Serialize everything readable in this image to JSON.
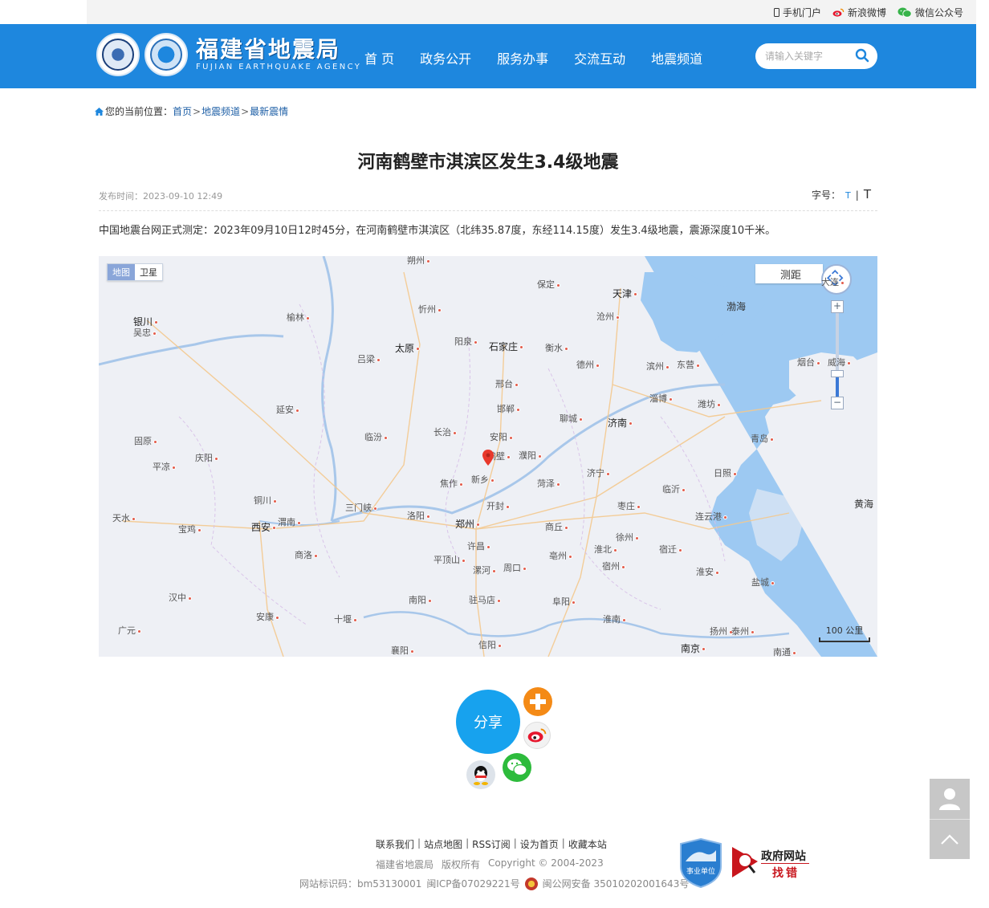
{
  "topbar": {
    "mobile": "手机门户",
    "weibo": "新浪微博",
    "wechat": "微信公众号"
  },
  "header": {
    "logo_cn": "福建省地震局",
    "logo_en": "FUJIAN EARTHQUAKE AGENCY",
    "nav": [
      "首 页",
      "政务公开",
      "服务办事",
      "交流互动",
      "地震频道"
    ],
    "search_placeholder": "请输入关键字"
  },
  "breadcrumb": {
    "prefix": "您的当前位置：",
    "items": [
      "首页",
      "地震频道",
      "最新震情"
    ],
    "sep": ">"
  },
  "article": {
    "title": "河南鹤壁市淇滨区发生3.4级地震",
    "date": "发布时间：2023-09-10 12:49",
    "font_label": "字号：",
    "font_small": "T",
    "font_sep": "|",
    "font_large": "T",
    "body": "中国地震台网正式测定：2023年09月10日12时45分，在河南鹤壁市淇滨区（北纬35.87度，东经114.15度）发生3.4级地震，震源深度10千米。"
  },
  "map": {
    "type_map": "地图",
    "type_sat": "卫星",
    "measure": "测距",
    "zoom_in": "+",
    "zoom_out": "−",
    "scale": "100 公里",
    "cities": [
      {
        "name": "朔州",
        "cls": ""
      },
      {
        "name": "保定",
        "cls": ""
      },
      {
        "name": "天津",
        "cls": "big"
      },
      {
        "name": "渤海",
        "cls": "sea"
      },
      {
        "name": "大连",
        "cls": ""
      },
      {
        "name": "银川",
        "cls": "big"
      },
      {
        "name": "吴忠",
        "cls": ""
      },
      {
        "name": "榆林",
        "cls": ""
      },
      {
        "name": "忻州",
        "cls": ""
      },
      {
        "name": "沧州",
        "cls": ""
      },
      {
        "name": "太原",
        "cls": "big"
      },
      {
        "name": "阳泉",
        "cls": ""
      },
      {
        "name": "石家庄",
        "cls": "big"
      },
      {
        "name": "衡水",
        "cls": ""
      },
      {
        "name": "吕梁",
        "cls": ""
      },
      {
        "name": "德州",
        "cls": ""
      },
      {
        "name": "滨州",
        "cls": ""
      },
      {
        "name": "东营",
        "cls": ""
      },
      {
        "name": "烟台",
        "cls": ""
      },
      {
        "name": "威海",
        "cls": ""
      },
      {
        "name": "邢台",
        "cls": ""
      },
      {
        "name": "淄博",
        "cls": ""
      },
      {
        "name": "潍坊",
        "cls": ""
      },
      {
        "name": "延安",
        "cls": ""
      },
      {
        "name": "邯郸",
        "cls": ""
      },
      {
        "name": "聊城",
        "cls": ""
      },
      {
        "name": "济南",
        "cls": "big"
      },
      {
        "name": "长治",
        "cls": ""
      },
      {
        "name": "临汾",
        "cls": ""
      },
      {
        "name": "安阳",
        "cls": ""
      },
      {
        "name": "青岛",
        "cls": ""
      },
      {
        "name": "固原",
        "cls": ""
      },
      {
        "name": "庆阳",
        "cls": ""
      },
      {
        "name": "鹤壁",
        "cls": ""
      },
      {
        "name": "濮阳",
        "cls": ""
      },
      {
        "name": "平凉",
        "cls": ""
      },
      {
        "name": "新乡",
        "cls": ""
      },
      {
        "name": "济宁",
        "cls": ""
      },
      {
        "name": "日照",
        "cls": ""
      },
      {
        "name": "焦作",
        "cls": ""
      },
      {
        "name": "菏泽",
        "cls": ""
      },
      {
        "name": "临沂",
        "cls": ""
      },
      {
        "name": "铜川",
        "cls": ""
      },
      {
        "name": "三门峡",
        "cls": ""
      },
      {
        "name": "开封",
        "cls": ""
      },
      {
        "name": "枣庄",
        "cls": ""
      },
      {
        "name": "黄海",
        "cls": "sea"
      },
      {
        "name": "天水",
        "cls": ""
      },
      {
        "name": "洛阳",
        "cls": ""
      },
      {
        "name": "连云港",
        "cls": ""
      },
      {
        "name": "宝鸡",
        "cls": ""
      },
      {
        "name": "西安",
        "cls": "big"
      },
      {
        "name": "渭南",
        "cls": ""
      },
      {
        "name": "郑州",
        "cls": "big"
      },
      {
        "name": "商丘",
        "cls": ""
      },
      {
        "name": "徐州",
        "cls": ""
      },
      {
        "name": "商洛",
        "cls": ""
      },
      {
        "name": "许昌",
        "cls": ""
      },
      {
        "name": "淮北",
        "cls": ""
      },
      {
        "name": "宿迁",
        "cls": ""
      },
      {
        "name": "平顶山",
        "cls": ""
      },
      {
        "name": "亳州",
        "cls": ""
      },
      {
        "name": "漯河",
        "cls": ""
      },
      {
        "name": "周口",
        "cls": ""
      },
      {
        "name": "宿州",
        "cls": ""
      },
      {
        "name": "淮安",
        "cls": ""
      },
      {
        "name": "盐城",
        "cls": ""
      },
      {
        "name": "汉中",
        "cls": ""
      },
      {
        "name": "南阳",
        "cls": ""
      },
      {
        "name": "驻马店",
        "cls": ""
      },
      {
        "name": "阜阳",
        "cls": ""
      },
      {
        "name": "安康",
        "cls": ""
      },
      {
        "name": "十堰",
        "cls": ""
      },
      {
        "name": "淮南",
        "cls": ""
      },
      {
        "name": "扬州",
        "cls": ""
      },
      {
        "name": "泰州",
        "cls": ""
      },
      {
        "name": "广元",
        "cls": ""
      },
      {
        "name": "襄阳",
        "cls": ""
      },
      {
        "name": "信阳",
        "cls": ""
      },
      {
        "name": "南京",
        "cls": "big"
      },
      {
        "name": "南通",
        "cls": ""
      }
    ]
  },
  "share": {
    "label": "分享"
  },
  "footer": {
    "links": [
      "联系我们",
      "站点地图",
      "RSS订阅",
      "设为首页",
      "收藏本站"
    ],
    "owner": "福建省地震局",
    "rights": "版权所有",
    "copyright": "Copyright © 2004-2023",
    "site_id": "网站标识码：bm53130001",
    "icp": "闽ICP备07029221号",
    "police": "闽公网安备 35010202001643号",
    "badge_sy": "事业单位",
    "gov_1": "政府网站",
    "gov_2": "找错"
  },
  "colors": {
    "header_blue": "#1e87de",
    "share_blue": "#17a2ee",
    "epicenter_red": "#e8382b"
  }
}
